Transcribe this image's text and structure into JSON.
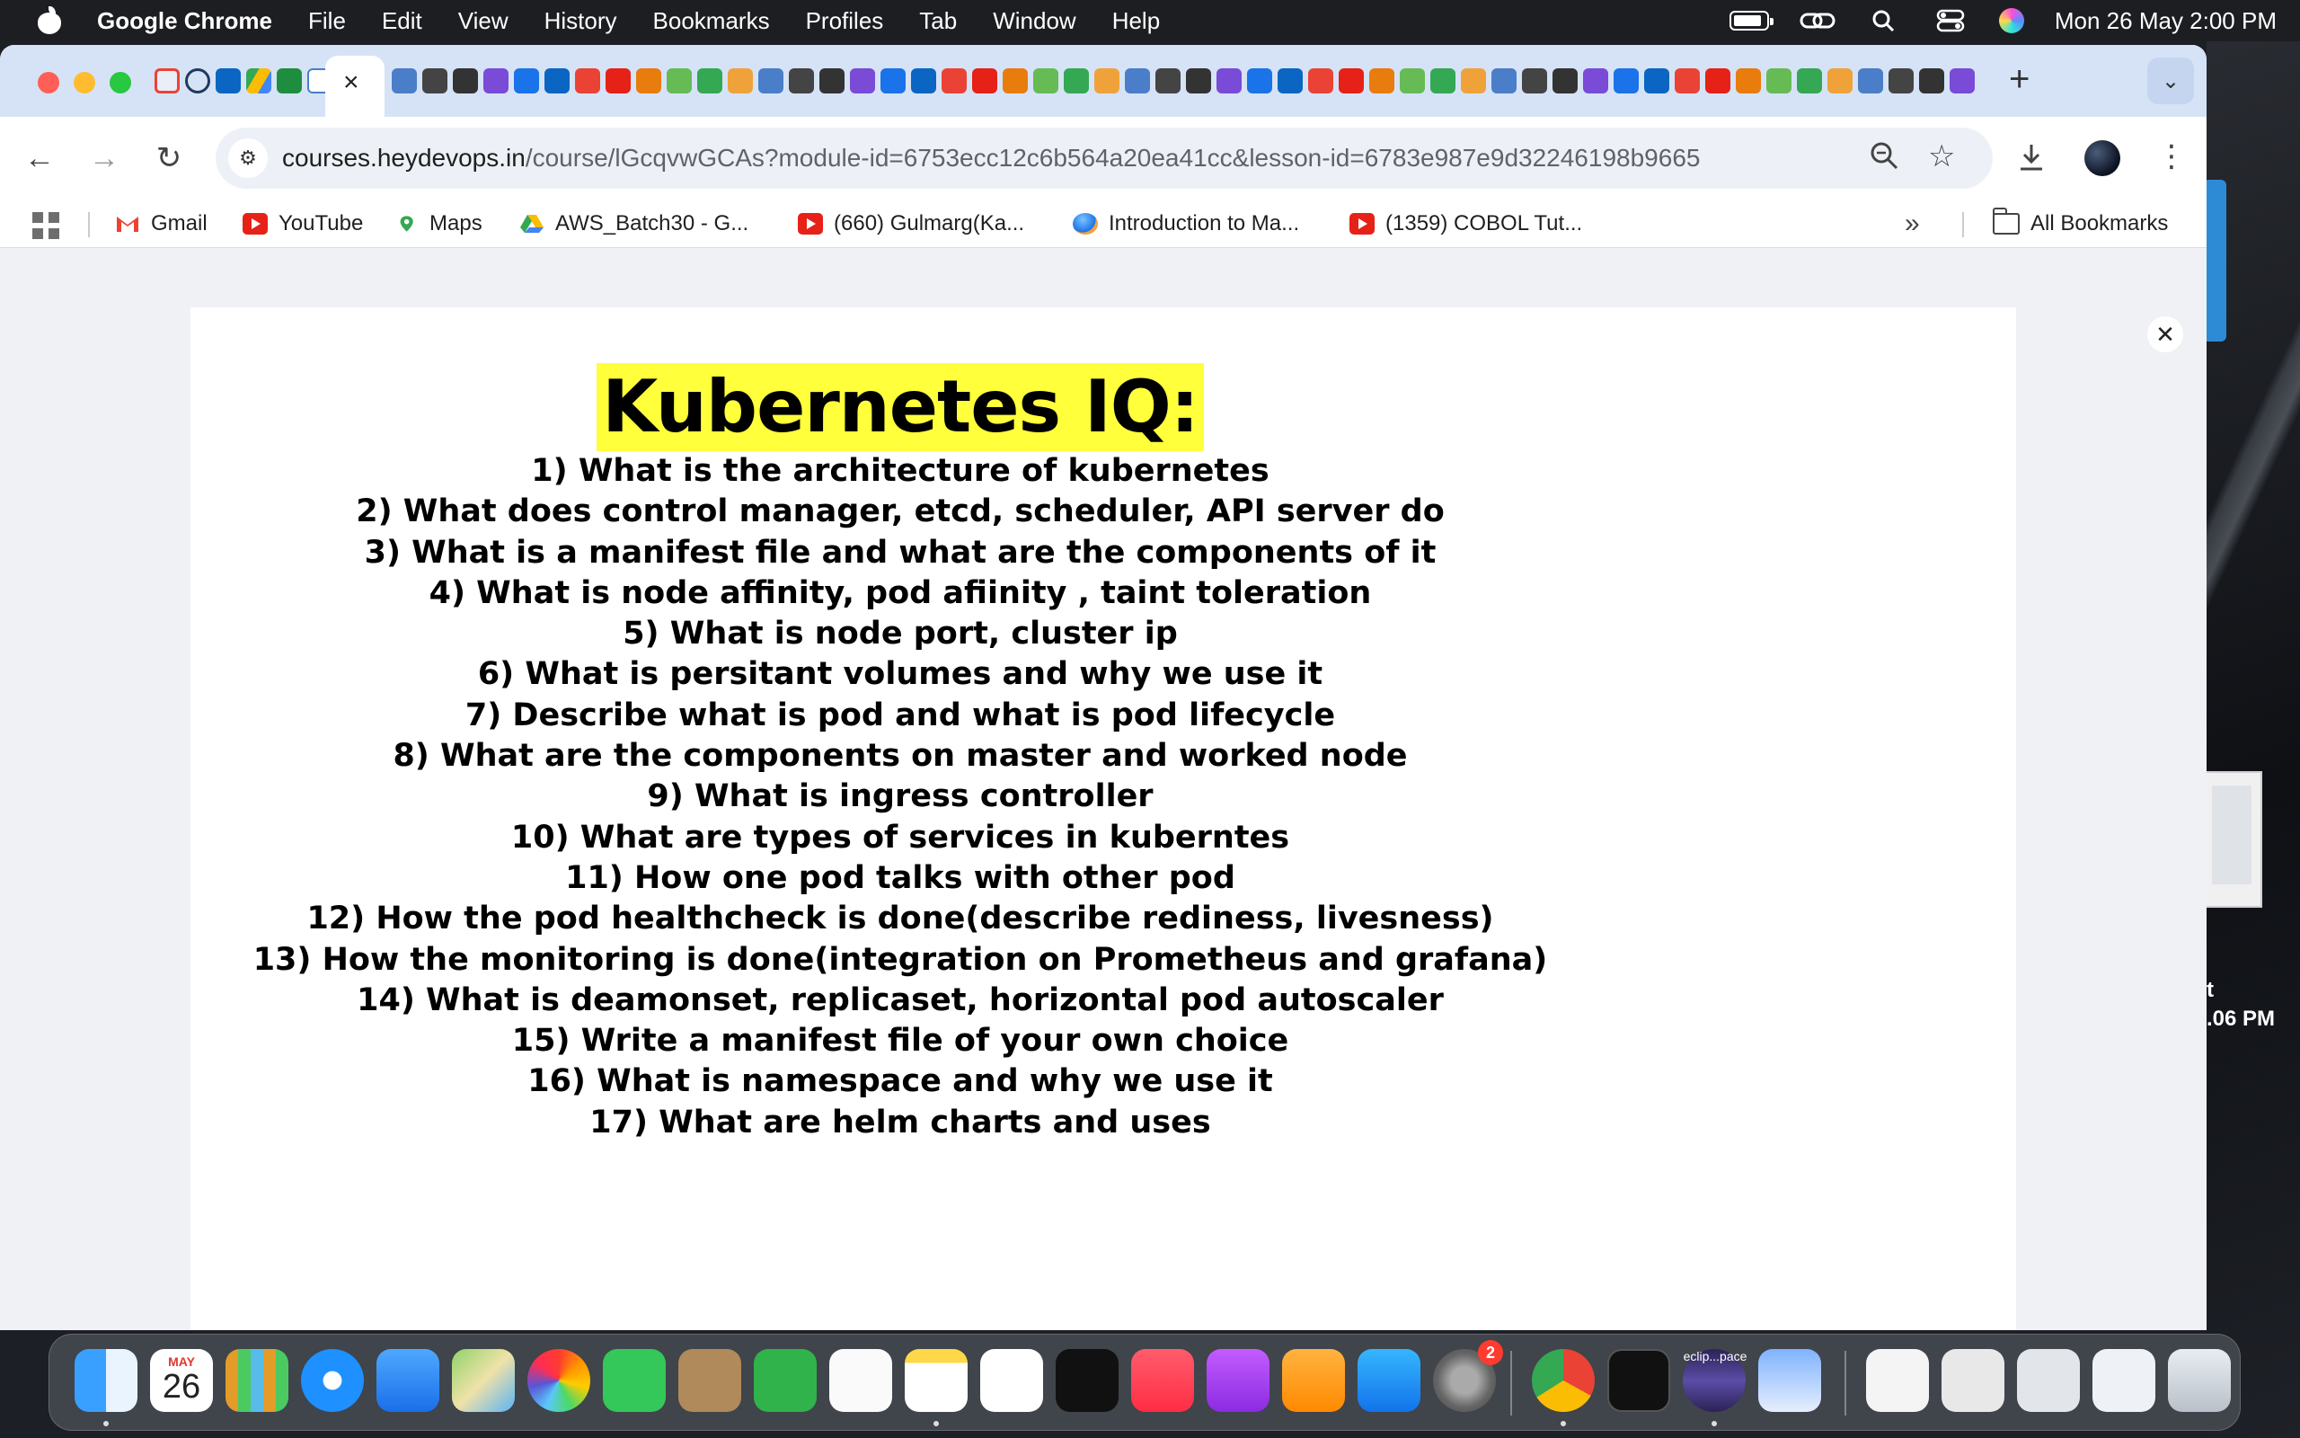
{
  "menubar": {
    "app_name": "Google Chrome",
    "items": [
      "File",
      "Edit",
      "View",
      "History",
      "Bookmarks",
      "Profiles",
      "Tab",
      "Window",
      "Help"
    ],
    "datetime": "Mon 26 May  2:00 PM"
  },
  "browser": {
    "url_host": "courses.heydevops.in",
    "url_path": "/course/lGcqvwGCAs?module-id=6753ecc12c6b564a20ea41cc&lesson-id=6783e987e9d32246198b9665",
    "new_tab_symbol": "+",
    "tab_close_symbol": "×"
  },
  "bookmarks": {
    "items": [
      {
        "label": "Gmail",
        "icon": "gmail-icon"
      },
      {
        "label": "YouTube",
        "icon": "youtube-icon"
      },
      {
        "label": "Maps",
        "icon": "maps-icon"
      },
      {
        "label": "AWS_Batch30 - G...",
        "icon": "drive-icon"
      },
      {
        "label": "(660) Gulmarg(Ka...",
        "icon": "youtube-icon"
      },
      {
        "label": "Introduction to Ma...",
        "icon": "site-icon"
      },
      {
        "label": "(1359) COBOL Tut...",
        "icon": "youtube-icon"
      }
    ],
    "all_bookmarks_label": "All Bookmarks",
    "more_symbol": "»"
  },
  "slide": {
    "title": "Kubernetes IQ:",
    "questions": [
      "1) What is the architecture of kubernetes",
      "2) What does control manager, etcd, scheduler, API server do",
      "3) What is a manifest file and what are the components of it",
      "4) What is node affinity, pod afiinity , taint toleration",
      "5) What is node port, cluster ip",
      "6) What is persitant volumes and why we use it",
      "7) Describe what is pod and what is pod lifecycle",
      "8) What are the components on master and worked node",
      "9) What is ingress controller",
      "10) What are types of services in kuberntes",
      "11) How one pod talks with other pod",
      "12) How the pod healthcheck is done(describe rediness, livesness)",
      "13) How the monitoring is done(integration on Prometheus and grafana)",
      "14) What is deamonset, replicaset, horizontal pod autoscaler",
      "15) Write a manifest file of your own choice",
      "16) What is namespace and why we use it",
      "17) What are helm charts and uses"
    ]
  },
  "desktop": {
    "partial_label_1": "t",
    "partial_label_2": ".06 PM"
  },
  "dock": {
    "calendar_month": "MAY",
    "calendar_day": "26",
    "settings_badge": "2",
    "eclipse_label": "eclip...pace"
  },
  "colors": {
    "title_highlight": "#ffff3b",
    "tabstrip": "#d6e3f7",
    "menubar": "#1d1e22"
  }
}
